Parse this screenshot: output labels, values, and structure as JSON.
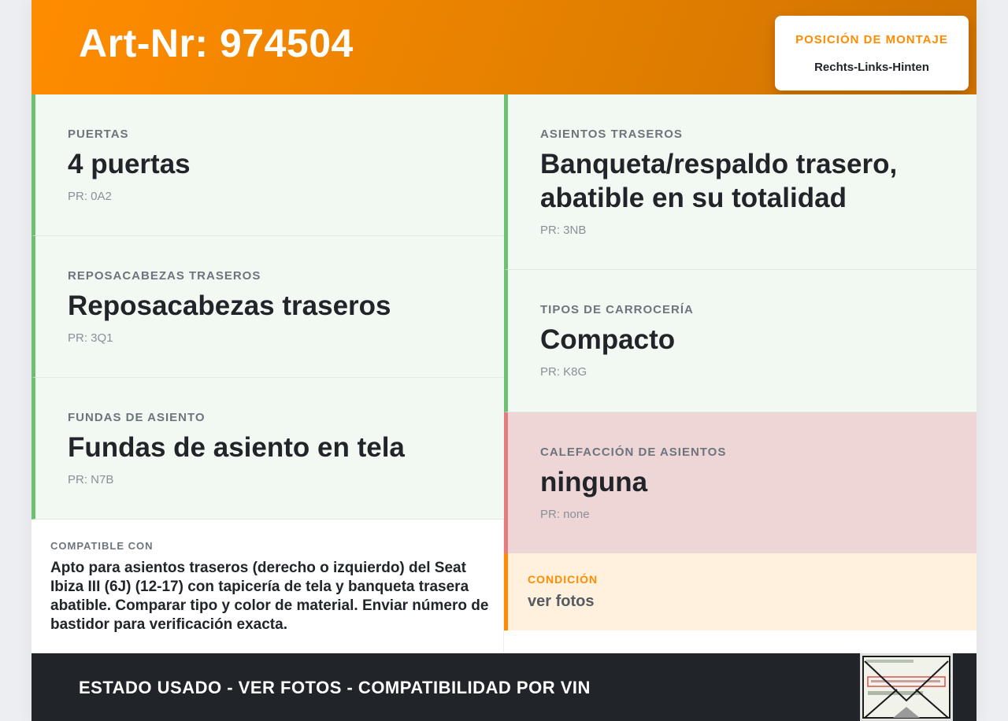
{
  "header": {
    "title": "Art-Nr: 974504",
    "mount_label": "POSICIÓN DE MONTAJE",
    "mount_value": "Rechts-Links-Hinten"
  },
  "features_left": [
    {
      "label": "PUERTAS",
      "value": "4 puertas",
      "pr": "PR: 0A2"
    },
    {
      "label": "REPOSACABEZAS TRASEROS",
      "value": "Reposacabezas traseros",
      "pr": "PR: 3Q1"
    },
    {
      "label": "FUNDAS DE ASIENTO",
      "value": "Fundas de asiento en tela",
      "pr": "PR: N7B"
    }
  ],
  "features_right": [
    {
      "label": "ASIENTOS TRASEROS",
      "value": "Banqueta/respaldo trasero, abatible en su totalidad",
      "pr": "PR: 3NB"
    },
    {
      "label": "TIPOS DE CARROCERÍA",
      "value": "Compacto",
      "pr": "PR: K8G"
    },
    {
      "label": "CALEFACCIÓN DE ASIENTOS",
      "value": "ninguna",
      "pr": "PR: none"
    }
  ],
  "compatible": {
    "label": "COMPATIBLE CON",
    "text": "Apto para asientos traseros (derecho o izquierdo) del Seat Ibiza III (6J) (12-17) con tapicería de tela y banqueta trasera abatible. Comparar tipo y color de material. Enviar número de bastidor para verificación exacta."
  },
  "condition": {
    "label": "CONDICIÓN",
    "value": "ver fotos"
  },
  "footer": {
    "text": "ESTADO USADO - VER FOTOS - COMPATIBILIDAD POR VIN",
    "thumbnail_icon": "document-thumbnail-icon"
  },
  "colors": {
    "accent": "#ff8c00",
    "green": "#6cc070",
    "red": "#e57a7f",
    "dark": "#212529"
  }
}
